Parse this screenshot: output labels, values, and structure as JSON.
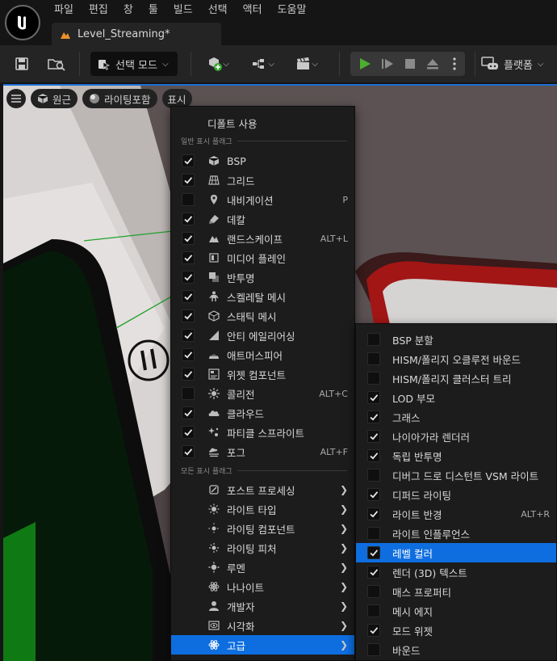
{
  "menubar": [
    "파일",
    "편집",
    "창",
    "툴",
    "빌드",
    "선택",
    "액터",
    "도움말"
  ],
  "document_tab": {
    "title": "Level_Streaming*"
  },
  "toolbar": {
    "mode_select": "선택 모드",
    "platform": "플랫폼"
  },
  "viewport_toolbar": {
    "perspective": "원근",
    "lighting": "라이팅포함",
    "show": "표시"
  },
  "show_menu": {
    "use_defaults": "디폴트 사용",
    "common_header": "일반 표시 플래그",
    "common_flags": [
      {
        "label": "BSP",
        "checked": true,
        "icon": "bsp-icon",
        "shortcut": ""
      },
      {
        "label": "그리드",
        "checked": true,
        "icon": "grid-icon",
        "shortcut": ""
      },
      {
        "label": "내비게이션",
        "checked": false,
        "icon": "location-pin-icon",
        "shortcut": "P"
      },
      {
        "label": "데칼",
        "checked": true,
        "icon": "decal-icon",
        "shortcut": ""
      },
      {
        "label": "랜드스케이프",
        "checked": true,
        "icon": "landscape-icon",
        "shortcut": "ALT+L"
      },
      {
        "label": "미디어 플레인",
        "checked": true,
        "icon": "media-plane-icon",
        "shortcut": ""
      },
      {
        "label": "반투명",
        "checked": true,
        "icon": "translucency-icon",
        "shortcut": ""
      },
      {
        "label": "스켈레탈 메시",
        "checked": true,
        "icon": "skeletal-mesh-icon",
        "shortcut": ""
      },
      {
        "label": "스태틱 메시",
        "checked": true,
        "icon": "static-mesh-icon",
        "shortcut": ""
      },
      {
        "label": "안티 에일리어싱",
        "checked": true,
        "icon": "anti-aliasing-icon",
        "shortcut": ""
      },
      {
        "label": "애트머스피어",
        "checked": true,
        "icon": "atmosphere-icon",
        "shortcut": ""
      },
      {
        "label": "위젯 컴포넌트",
        "checked": true,
        "icon": "widget-component-icon",
        "shortcut": ""
      },
      {
        "label": "콜리전",
        "checked": false,
        "icon": "collision-icon",
        "shortcut": "ALT+C"
      },
      {
        "label": "클라우드",
        "checked": true,
        "icon": "cloud-icon",
        "shortcut": ""
      },
      {
        "label": "파티클 스프라이트",
        "checked": true,
        "icon": "particle-sprite-icon",
        "shortcut": ""
      },
      {
        "label": "포그",
        "checked": true,
        "icon": "fog-icon",
        "shortcut": "ALT+F"
      }
    ],
    "all_header": "모든 표시 플래그",
    "categories": [
      {
        "label": "포스트 프로세싱",
        "icon": "post-process-icon"
      },
      {
        "label": "라이트 타입",
        "icon": "light-type-icon"
      },
      {
        "label": "라이팅 컴포넌트",
        "icon": "lighting-component-icon"
      },
      {
        "label": "라이팅 피처",
        "icon": "lighting-feature-icon"
      },
      {
        "label": "루멘",
        "icon": "lumen-icon"
      },
      {
        "label": "나나이트",
        "icon": "nanite-icon"
      },
      {
        "label": "개발자",
        "icon": "developer-icon"
      },
      {
        "label": "시각화",
        "icon": "visualize-icon"
      },
      {
        "label": "고급",
        "icon": "advanced-icon"
      }
    ],
    "active_category": "고급"
  },
  "advanced_menu": {
    "items": [
      {
        "label": "BSP 분할",
        "checked": false,
        "shortcut": ""
      },
      {
        "label": "HISM/폴리지 오클루전 바운드",
        "checked": false,
        "shortcut": ""
      },
      {
        "label": "HISM/폴리지 클러스터 트리",
        "checked": false,
        "shortcut": ""
      },
      {
        "label": "LOD 부모",
        "checked": true,
        "shortcut": ""
      },
      {
        "label": "그래스",
        "checked": true,
        "shortcut": ""
      },
      {
        "label": "나이아가라 렌더러",
        "checked": true,
        "shortcut": ""
      },
      {
        "label": "독립 반투명",
        "checked": true,
        "shortcut": ""
      },
      {
        "label": "디버그 드로 디스턴트 VSM 라이트",
        "checked": false,
        "shortcut": ""
      },
      {
        "label": "디퍼드 라이팅",
        "checked": true,
        "shortcut": ""
      },
      {
        "label": "라이트 반경",
        "checked": true,
        "shortcut": "ALT+R"
      },
      {
        "label": "라이트 인플루언스",
        "checked": false,
        "shortcut": ""
      },
      {
        "label": "레벨 컬러",
        "checked": true,
        "shortcut": ""
      },
      {
        "label": "렌더 (3D) 텍스트",
        "checked": true,
        "shortcut": ""
      },
      {
        "label": "매스 프로퍼티",
        "checked": false,
        "shortcut": ""
      },
      {
        "label": "메시 에지",
        "checked": false,
        "shortcut": ""
      },
      {
        "label": "모드 위젯",
        "checked": true,
        "shortcut": ""
      },
      {
        "label": "바운드",
        "checked": false,
        "shortcut": ""
      }
    ],
    "highlighted": "레벨 컬러"
  },
  "colors": {
    "accent": "#0e6ee0",
    "play": "#4caf2f",
    "menu_bg": "#1c1c1c"
  }
}
